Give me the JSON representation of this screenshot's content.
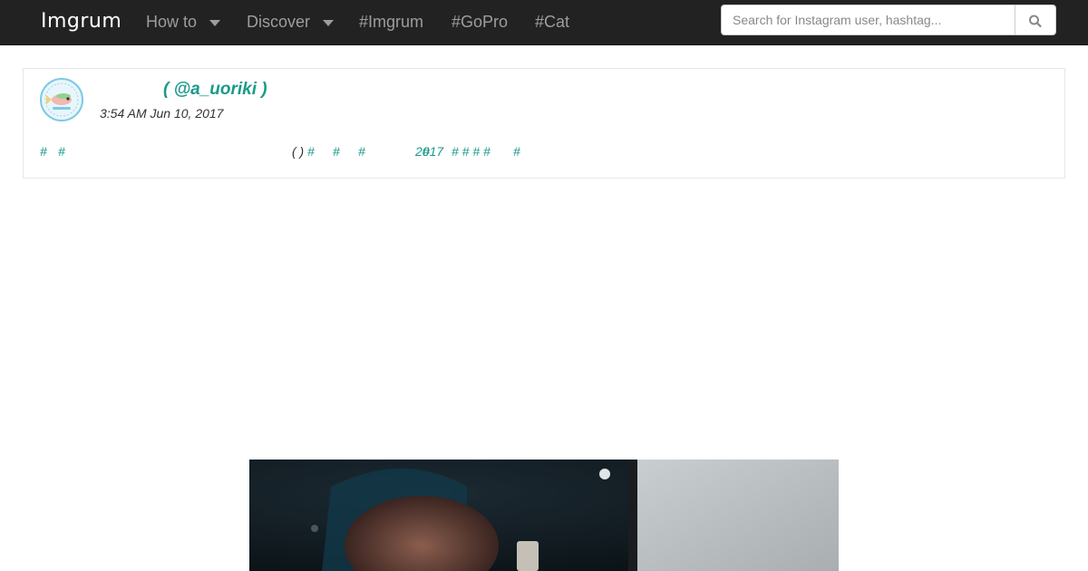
{
  "navbar": {
    "brand": "Imgrum",
    "items": [
      {
        "label": "How to",
        "dropdown": true
      },
      {
        "label": "Discover",
        "dropdown": true
      },
      {
        "label": "#Imgrum",
        "dropdown": false
      },
      {
        "label": "#GoPro",
        "dropdown": false
      },
      {
        "label": "#Cat",
        "dropdown": false
      }
    ],
    "search": {
      "placeholder": "Search for Instagram user, hashtag...",
      "button_icon": "search-icon"
    }
  },
  "post": {
    "username": "( @a_uoriki )",
    "timestamp": "3:54 AM Jun 10, 2017",
    "caption": {
      "hash_1": "#",
      "hash_2": "#",
      "parens": "( )",
      "hash_3": "#",
      "hash_4": "#",
      "hash_5": "#",
      "overlap_a": "2017",
      "overlap_b": "#",
      "hash_run": "# # # #",
      "hash_6": "#"
    },
    "avatar_icon": "fish-avatar-icon",
    "photo_icon": "post-photo"
  },
  "colors": {
    "navbar_bg": "#222222",
    "nav_text": "#9d9d9d",
    "link_teal": "#1a9a8a",
    "text_dark": "#333333"
  }
}
